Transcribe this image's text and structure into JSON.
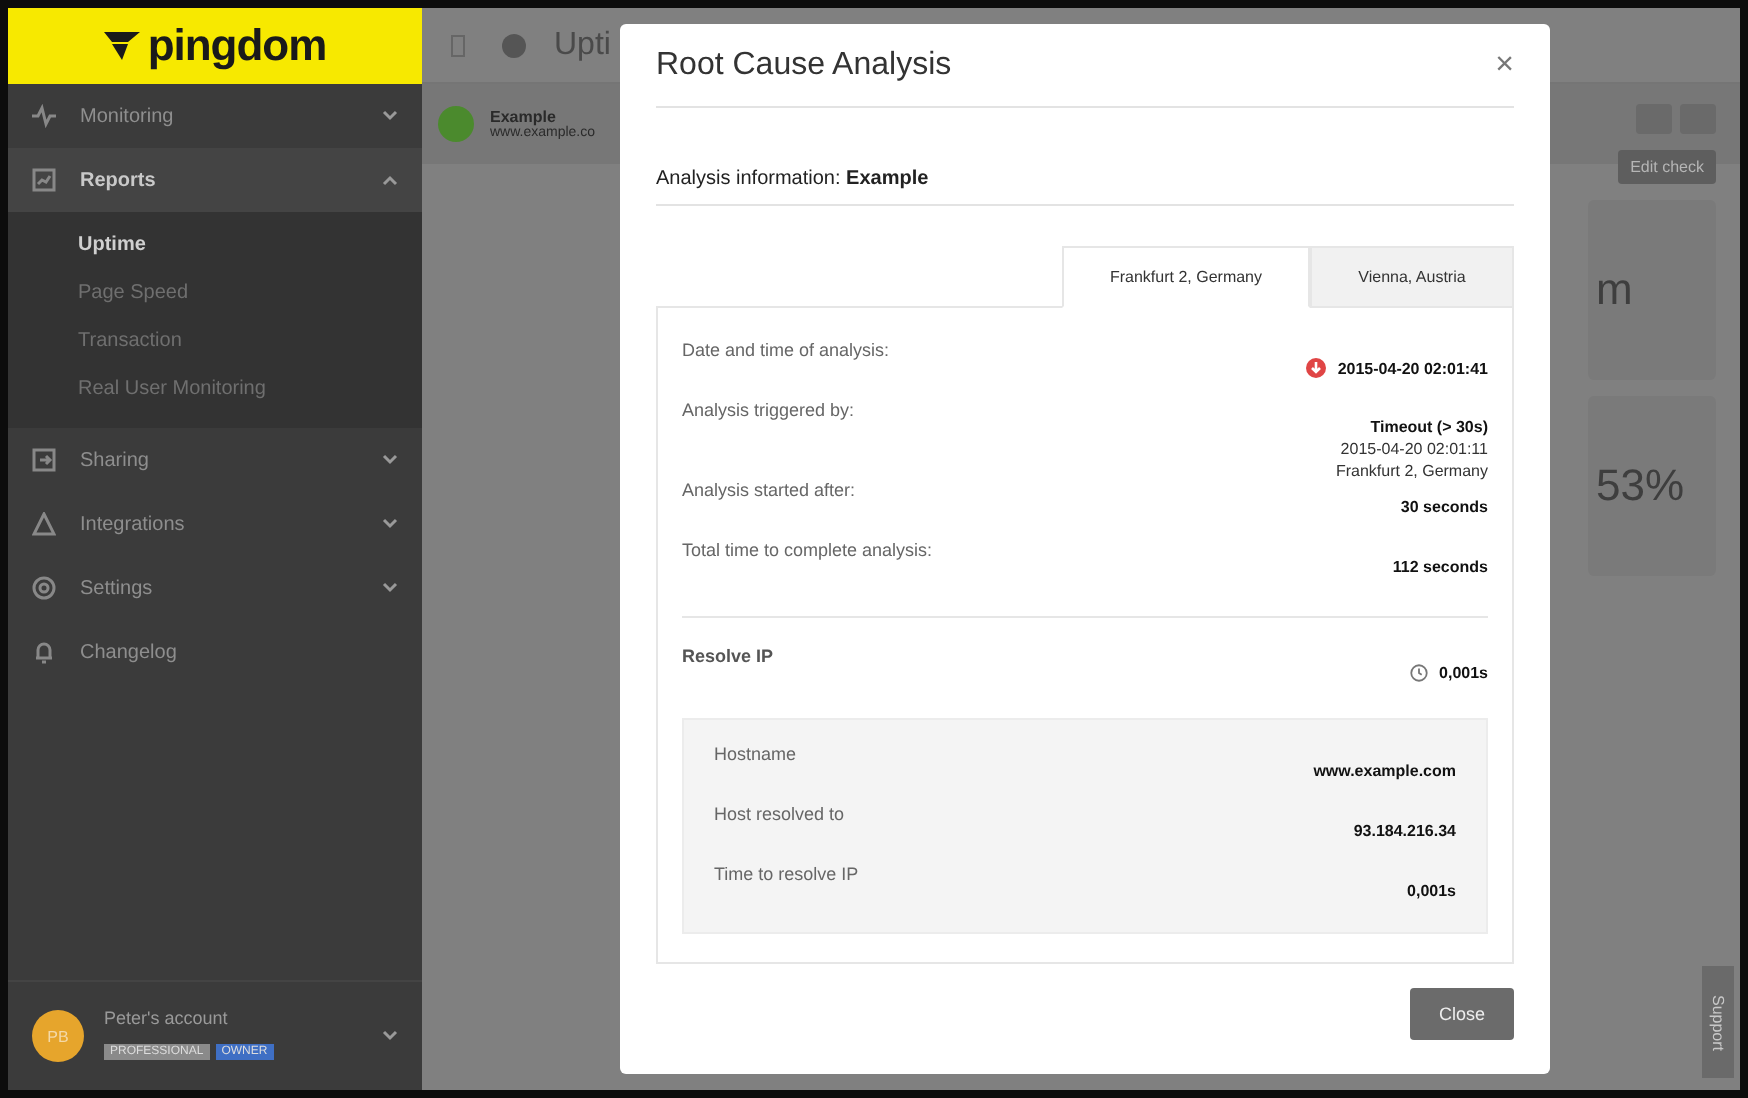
{
  "sidebar": {
    "logo": "pingdom",
    "items": [
      {
        "kind": "pulse",
        "label": "Monitoring",
        "expanded": false,
        "selected": false
      },
      {
        "kind": "chart",
        "label": "Reports",
        "expanded": true,
        "selected": true,
        "children": [
          {
            "label": "Uptime",
            "selected": true
          },
          {
            "label": "Page Speed",
            "selected": false
          },
          {
            "label": "Transaction",
            "selected": false
          },
          {
            "label": "Real User Monitoring",
            "selected": false
          }
        ]
      },
      {
        "kind": "share",
        "label": "Sharing",
        "expanded": false,
        "selected": false
      },
      {
        "kind": "integrations",
        "label": "Integrations",
        "expanded": false,
        "selected": false
      },
      {
        "kind": "gear",
        "label": "Settings",
        "expanded": false,
        "selected": false
      },
      {
        "kind": "bell",
        "label": "Changelog",
        "selected": false
      }
    ],
    "account": {
      "initials": "PB",
      "name": "Peter's account",
      "badges": [
        {
          "label": "PROFESSIONAL",
          "color": "#8a8a8a"
        },
        {
          "label": "OWNER",
          "color": "#3f6fc4"
        }
      ]
    }
  },
  "main": {
    "title": "Upti",
    "check": {
      "name": "Example",
      "url": "www.example.co"
    },
    "edit_button": "Edit check",
    "stat_values": [
      "m",
      "53%"
    ],
    "support": "Support"
  },
  "modal": {
    "title": "Root Cause Analysis",
    "close_icon": "×",
    "info": "Analysis information: **Example**",
    "tabs": [
      {
        "label": "Frankfurt 2, Germany",
        "selected": true
      },
      {
        "label": "Vienna, Austria",
        "selected": false
      }
    ],
    "rows": [
      {
        "label": "Date and time of analysis:",
        "value": "2015-04-20 02:01:41",
        "kind": "down"
      },
      {
        "label": "Analysis triggered by:",
        "value": "Timeout (> 30s)",
        "details": [
          "2015-04-20 02:01:11",
          "Frankfurt 2, Germany"
        ]
      },
      {
        "label": "Analysis started after:",
        "value": "30 seconds"
      },
      {
        "label": "Total time to complete analysis:",
        "value": "112 seconds"
      }
    ],
    "resolve": {
      "title": "Resolve IP",
      "time": "0,001s",
      "rows": [
        {
          "label": "Hostname",
          "value": "www.example.com"
        },
        {
          "label": "Host resolved to",
          "value": "93.184.216.34"
        },
        {
          "label": "Time to resolve IP",
          "value": "0,001s"
        }
      ]
    },
    "close_button": "Close"
  }
}
